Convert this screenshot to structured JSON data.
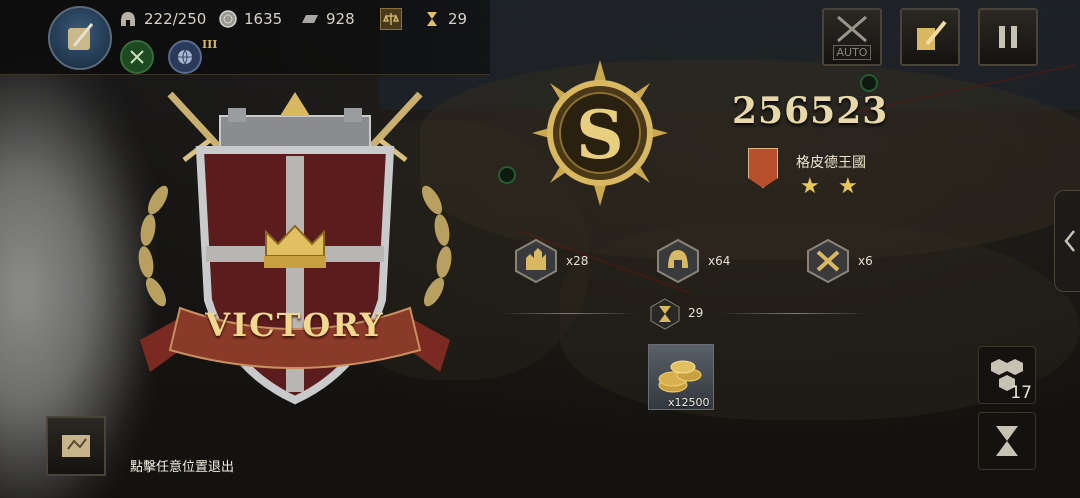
{
  "hud": {
    "manpower": "222/250",
    "silver": "1635",
    "iron": "928",
    "turn": "29",
    "tier": "III"
  },
  "buttons": {
    "auto_label": "AUTO"
  },
  "result": {
    "banner_text": "VICTORY",
    "score": "256523",
    "nation": "格皮德王國",
    "stars": [
      "★",
      "★"
    ]
  },
  "stats": [
    {
      "icon": "city-icon",
      "label": "x28"
    },
    {
      "icon": "helmet-icon",
      "label": "x64"
    },
    {
      "icon": "crossed-swords-icon",
      "label": "x6"
    }
  ],
  "turns": "29",
  "reward": {
    "label": "x12500",
    "icon": "gold-coins-icon"
  },
  "exit_hint": "點擊任意位置退出",
  "side": {
    "hex_count": "17"
  },
  "colors": {
    "accent_gold": "#d8b860",
    "banner_red": "#7a2a20",
    "shield_red": "#5a1c1c"
  }
}
